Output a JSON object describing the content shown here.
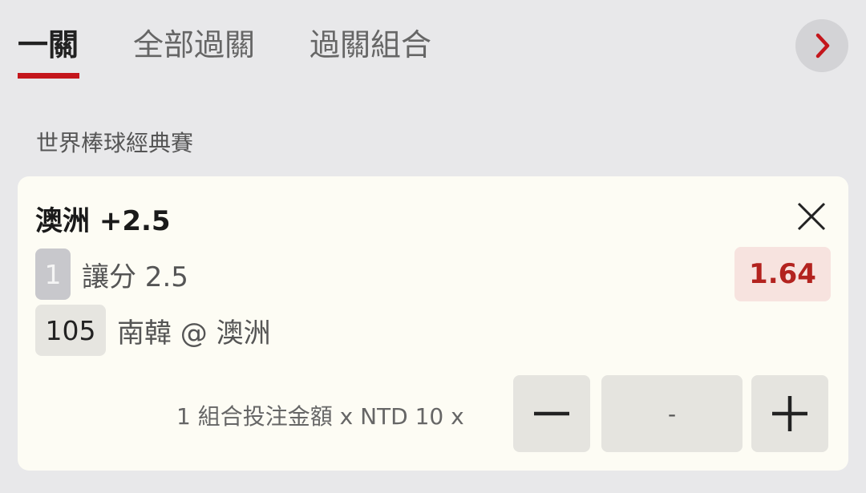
{
  "tabs": [
    {
      "label": "一關",
      "active": true
    },
    {
      "label": "全部過關",
      "active": false
    },
    {
      "label": "過關組合",
      "active": false
    }
  ],
  "accent_color": "#c4161c",
  "icons": {
    "next": "chevron-right-icon",
    "close": "close-icon",
    "minus": "minus-icon",
    "plus": "plus-icon"
  },
  "section": {
    "title": "世界棒球經典賽"
  },
  "bet": {
    "title": "澳洲 +2.5",
    "line_number": "1",
    "market": "讓分 2.5",
    "event_number": "105",
    "event": "南韓 @ 澳洲",
    "odds": "1.64"
  },
  "stake": {
    "label": "1 組合投注金額 x NTD 10 x",
    "amount": "-"
  }
}
